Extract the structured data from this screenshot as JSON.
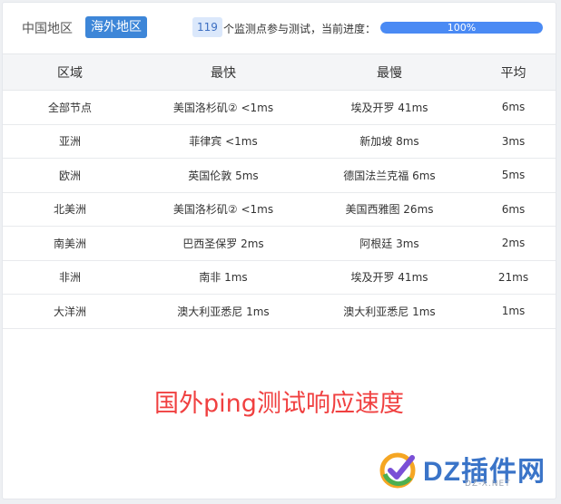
{
  "tabs": {
    "china": "中国地区",
    "overseas": "海外地区"
  },
  "status": {
    "count": "119",
    "text": "个监测点参与测试，当前进度：",
    "progress_label": "100%",
    "progress_fraction": 1.0
  },
  "table": {
    "headers": [
      "区域",
      "最快",
      "最慢",
      "平均"
    ],
    "rows": [
      [
        "全部节点",
        "美国洛杉矶② <1ms",
        "埃及开罗 41ms",
        "6ms"
      ],
      [
        "亚洲",
        "菲律宾 <1ms",
        "新加坡 8ms",
        "3ms"
      ],
      [
        "欧洲",
        "英国伦敦 5ms",
        "德国法兰克福 6ms",
        "5ms"
      ],
      [
        "北美洲",
        "美国洛杉矶② <1ms",
        "美国西雅图 26ms",
        "6ms"
      ],
      [
        "南美洲",
        "巴西圣保罗 2ms",
        "阿根廷 3ms",
        "2ms"
      ],
      [
        "非洲",
        "南非 1ms",
        "埃及开罗 41ms",
        "21ms"
      ],
      [
        "大洋洲",
        "澳大利亚悉尼 1ms",
        "澳大利亚悉尼 1ms",
        "1ms"
      ]
    ]
  },
  "caption": "国外ping测试响应速度",
  "watermark": {
    "brand": "DZ插件网",
    "url": "DZ-X.NET"
  },
  "colors": {
    "accent": "#3d86d8",
    "progress": "#4a8af4",
    "caption": "#f04040"
  }
}
